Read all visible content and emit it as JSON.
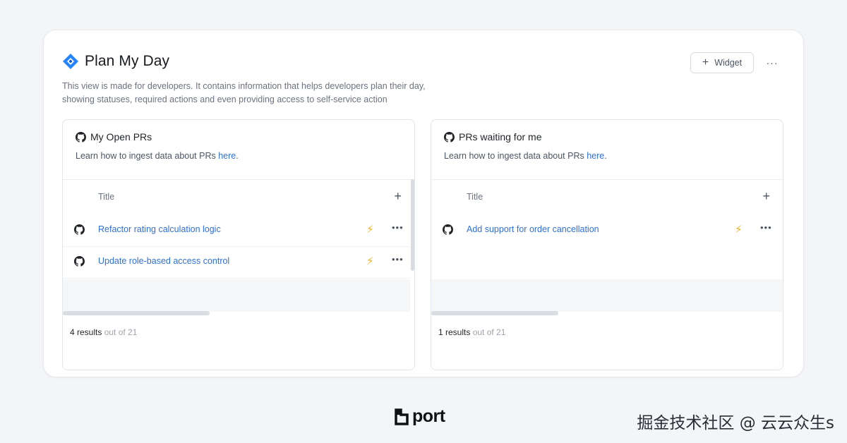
{
  "page": {
    "title": "Plan My Day",
    "description": "This view is made for developers. It contains information that helps developers plan their day, showing statuses, required actions and even providing access to self-service action",
    "widget_button": "Widget",
    "more_label": "···"
  },
  "panels": [
    {
      "title": "My Open PRs",
      "sub_prefix": "Learn how to ingest data about PRs ",
      "sub_link": "here",
      "sub_suffix": ".",
      "column_title": "Title",
      "rows": [
        {
          "title": "Refactor rating calculation logic"
        },
        {
          "title": "Update role-based access control"
        }
      ],
      "results_count": "4 results",
      "results_total": "out of 21"
    },
    {
      "title": "PRs waiting for me",
      "sub_prefix": "Learn how to ingest data about PRs ",
      "sub_link": "here",
      "sub_suffix": ".",
      "column_title": "Title",
      "rows": [
        {
          "title": "Add support for order cancellation"
        }
      ],
      "results_count": "1 results",
      "results_total": "out of 21"
    }
  ],
  "brand": {
    "name": "port"
  },
  "watermark": "掘金技术社区 @ 云云众生s",
  "colors": {
    "link": "#2f6fd8",
    "bolt": "#f2b21c",
    "jira": "#2684ff"
  }
}
